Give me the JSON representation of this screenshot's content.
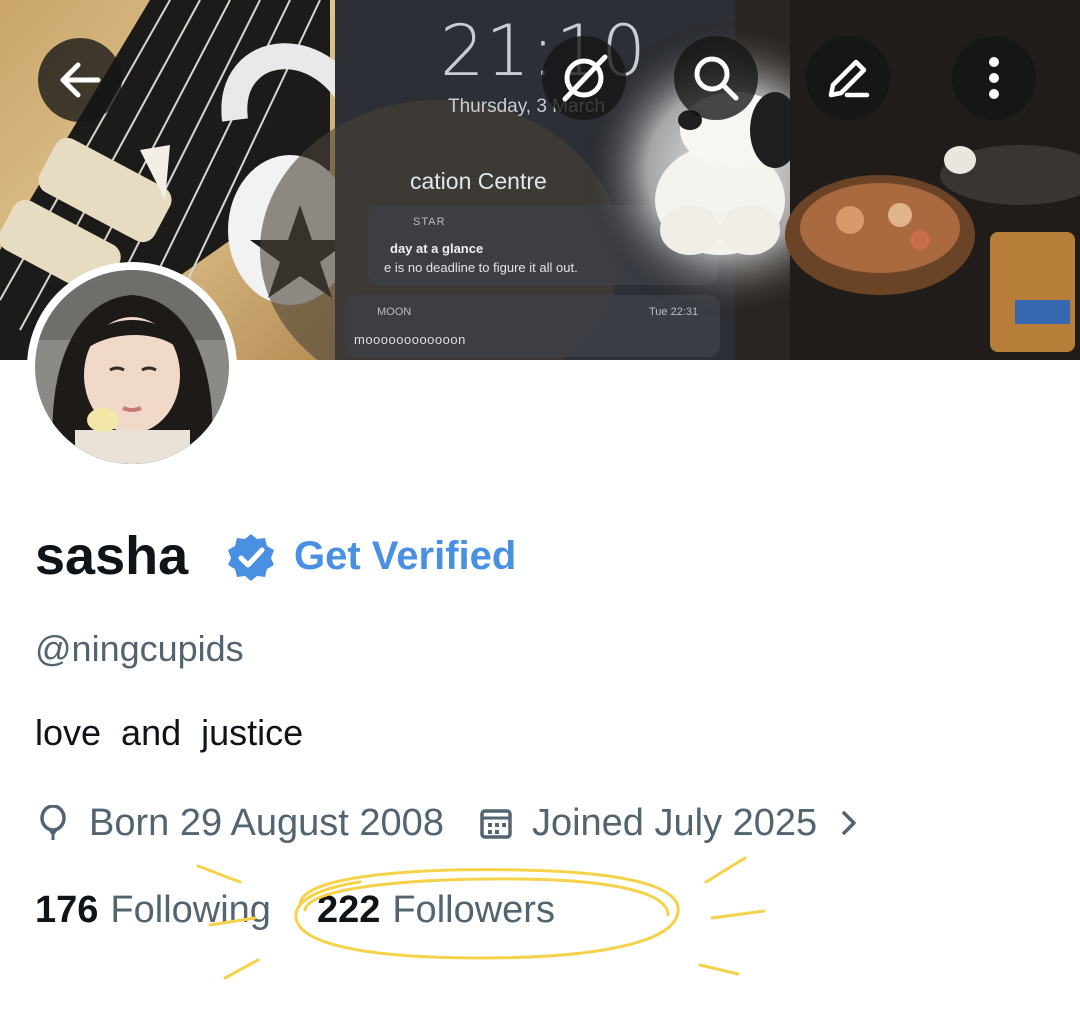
{
  "header": {
    "back_icon": "arrow-left-icon",
    "grok_icon": "grok-icon",
    "search_icon": "search-icon",
    "edit_icon": "edit-pencil-icon",
    "more_icon": "more-vertical-icon"
  },
  "banner": {
    "lock_time": "21:10",
    "lock_date": "Thursday, 3 March",
    "notification_title": "cation Centre",
    "star_app": "STAR",
    "star_line1": "day at a glance",
    "star_line2": "e is no deadline to figure it all out.",
    "moon_app": "MOON",
    "moon_time": "Tue 22:31",
    "moon_message": "moooooooooooon"
  },
  "profile": {
    "display_name": "sasha",
    "verified_badge_icon": "verified-badge-icon",
    "get_verified_label": "Get Verified",
    "handle": "@ningcupids",
    "bio": "love  and  justice",
    "birthday": "Born 29 August 2008",
    "joined": "Joined July 2025",
    "birthday_icon": "balloon-icon",
    "joined_icon": "calendar-icon"
  },
  "stats": {
    "following_count": "176",
    "following_label": "Following",
    "followers_count": "222",
    "followers_label": "Followers"
  },
  "colors": {
    "link_blue": "#4a90e2",
    "secondary_text": "#536471",
    "primary_text": "#0f1419",
    "highlight_yellow": "#f5d24a"
  }
}
